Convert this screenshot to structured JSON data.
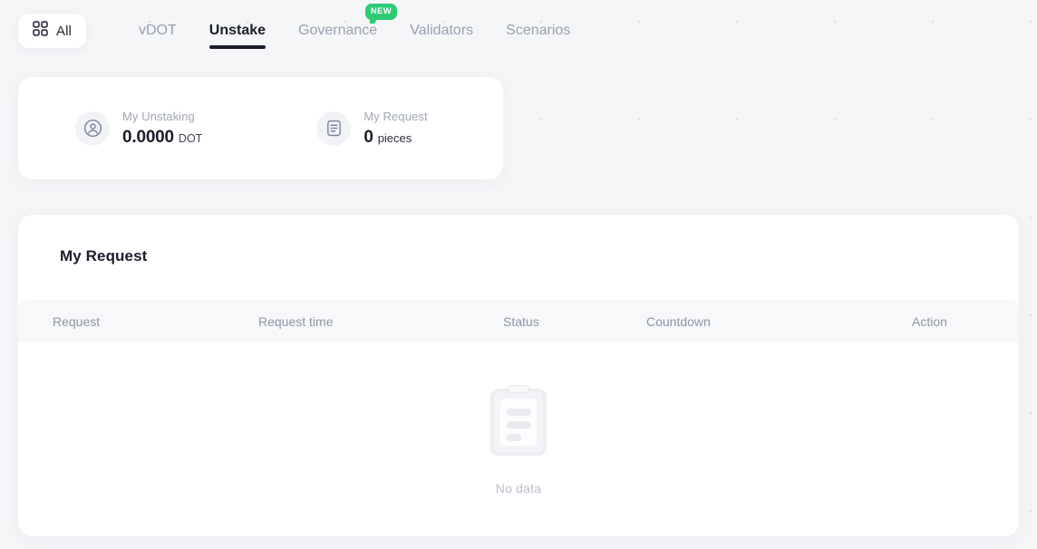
{
  "nav": {
    "all_button": {
      "label": "All",
      "icon": "grid-icon"
    },
    "tabs": [
      {
        "label": "vDOT",
        "active": false,
        "badge": null
      },
      {
        "label": "Unstake",
        "active": true,
        "badge": null
      },
      {
        "label": "Governance",
        "active": false,
        "badge": "NEW"
      },
      {
        "label": "Validators",
        "active": false,
        "badge": null
      },
      {
        "label": "Scenarios",
        "active": false,
        "badge": null
      }
    ]
  },
  "summary": {
    "stats": [
      {
        "icon": "user-circle-icon",
        "label": "My Unstaking",
        "value": "0.0000",
        "unit": "DOT"
      },
      {
        "icon": "document-list-icon",
        "label": "My Request",
        "value": "0",
        "unit": "pieces"
      }
    ]
  },
  "request_table": {
    "title": "My Request",
    "columns": [
      "Request",
      "Request time",
      "Status",
      "Countdown",
      "Action"
    ],
    "rows": [],
    "empty_state": {
      "icon": "empty-clipboard-icon",
      "text": "No data"
    }
  },
  "colors": {
    "page_background": "#f5f6f8",
    "card_background": "#ffffff",
    "accent_badge_green": "#2ecb73",
    "text_primary": "#1b1e2b",
    "text_muted": "#9aa0b0",
    "table_header_background": "#f7f8fa"
  }
}
